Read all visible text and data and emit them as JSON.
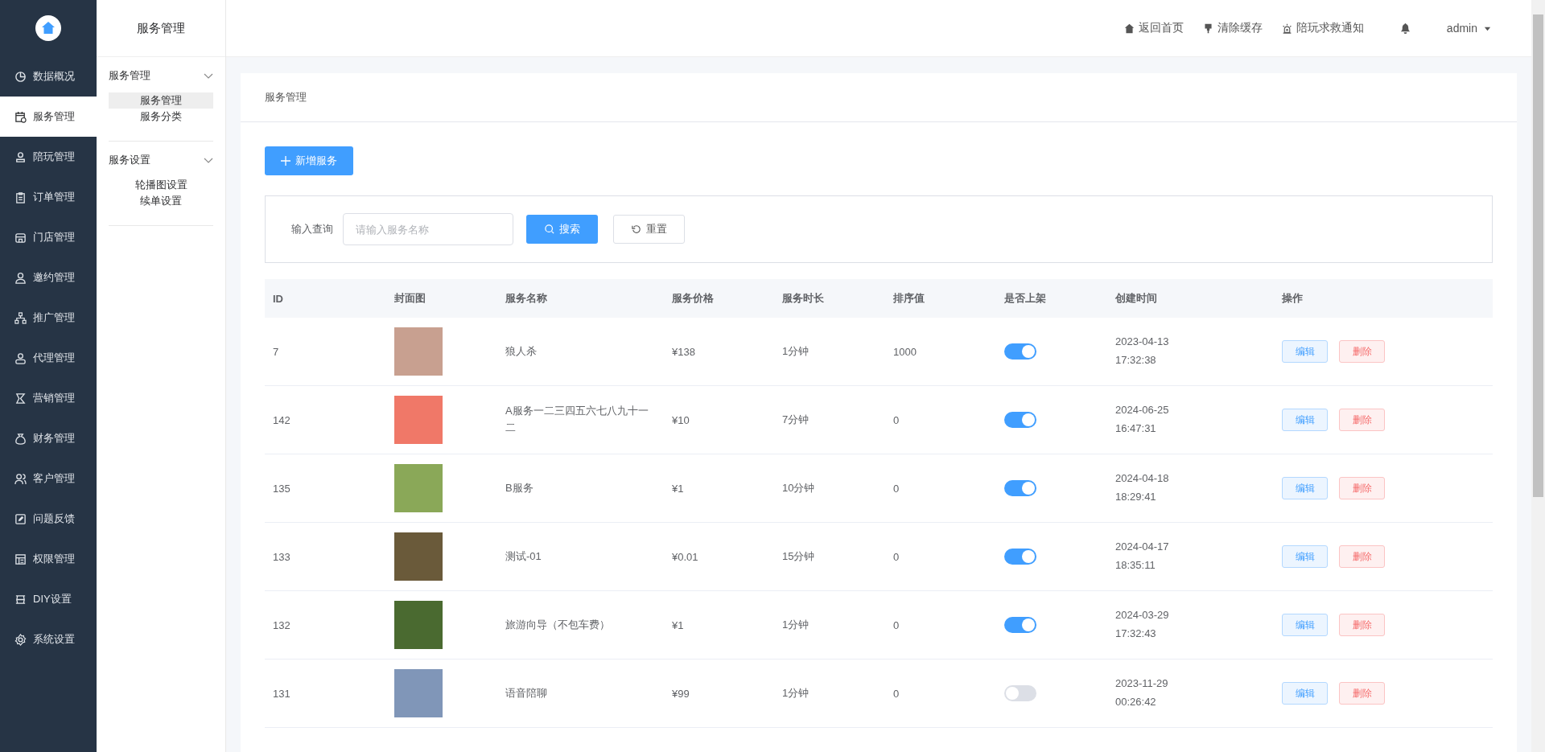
{
  "sidebar": {
    "items": [
      {
        "label": "数据概况",
        "selected": false
      },
      {
        "label": "服务管理",
        "selected": true
      },
      {
        "label": "陪玩管理",
        "selected": false
      },
      {
        "label": "订单管理",
        "selected": false
      },
      {
        "label": "门店管理",
        "selected": false
      },
      {
        "label": "邀约管理",
        "selected": false
      },
      {
        "label": "推广管理",
        "selected": false
      },
      {
        "label": "代理管理",
        "selected": false
      },
      {
        "label": "营销管理",
        "selected": false
      },
      {
        "label": "财务管理",
        "selected": false
      },
      {
        "label": "客户管理",
        "selected": false
      },
      {
        "label": "问题反馈",
        "selected": false
      },
      {
        "label": "权限管理",
        "selected": false
      },
      {
        "label": "DIY设置",
        "selected": false
      },
      {
        "label": "系统设置",
        "selected": false
      }
    ]
  },
  "submenu": {
    "title": "服务管理",
    "groups": [
      {
        "title": "服务管理",
        "expanded": true,
        "items": [
          {
            "label": "服务管理",
            "selected": true
          },
          {
            "label": "服务分类",
            "selected": false
          }
        ]
      },
      {
        "title": "服务设置",
        "expanded": true,
        "items": [
          {
            "label": "轮播图设置",
            "selected": false
          },
          {
            "label": "续单设置",
            "selected": false
          }
        ]
      }
    ]
  },
  "header": {
    "links": [
      "返回首页",
      "清除缓存",
      "陪玩求救通知"
    ],
    "user": "admin"
  },
  "breadcrumb": "服务管理",
  "add_button": "新增服务",
  "search": {
    "label": "输入查询",
    "placeholder": "请输入服务名称",
    "search_button": "搜索",
    "reset_button": "重置"
  },
  "table": {
    "columns": [
      "ID",
      "封面图",
      "服务名称",
      "服务价格",
      "服务时长",
      "排序值",
      "是否上架",
      "创建时间",
      "操作"
    ],
    "rows": [
      {
        "id": "7",
        "name": "狼人杀",
        "price": "¥138",
        "duration": "1分钟",
        "sort": "1000",
        "on": true,
        "date": "2023-04-13",
        "time": "17:32:38",
        "edit": "编辑",
        "delete": "删除"
      },
      {
        "id": "142",
        "name": "A服务一二三四五六七八九十一二",
        "price": "¥10",
        "duration": "7分钟",
        "sort": "0",
        "on": true,
        "date": "2024-06-25",
        "time": "16:47:31",
        "edit": "编辑",
        "delete": "删除"
      },
      {
        "id": "135",
        "name": "B服务",
        "price": "¥1",
        "duration": "10分钟",
        "sort": "0",
        "on": true,
        "date": "2024-04-18",
        "time": "18:29:41",
        "edit": "编辑",
        "delete": "删除"
      },
      {
        "id": "133",
        "name": "测试-01",
        "price": "¥0.01",
        "duration": "15分钟",
        "sort": "0",
        "on": true,
        "date": "2024-04-17",
        "time": "18:35:11",
        "edit": "编辑",
        "delete": "删除"
      },
      {
        "id": "132",
        "name": "旅游向导（不包车费）",
        "price": "¥1",
        "duration": "1分钟",
        "sort": "0",
        "on": true,
        "date": "2024-03-29",
        "time": "17:32:43",
        "edit": "编辑",
        "delete": "删除"
      },
      {
        "id": "131",
        "name": "语音陪聊",
        "price": "¥99",
        "duration": "1分钟",
        "sort": "0",
        "on": false,
        "date": "2023-11-29",
        "time": "00:26:42",
        "edit": "编辑",
        "delete": "删除"
      }
    ]
  }
}
